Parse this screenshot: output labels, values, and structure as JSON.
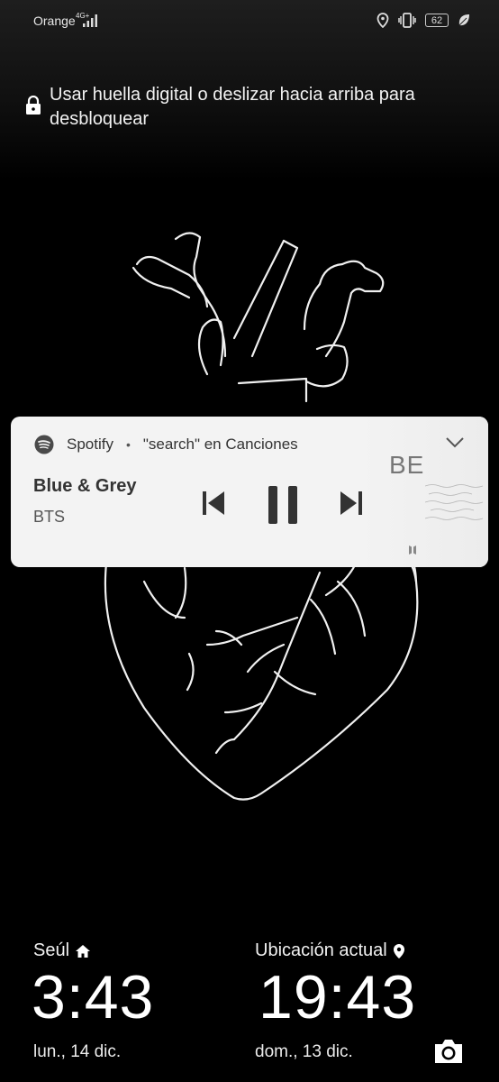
{
  "status_bar": {
    "carrier": "Orange",
    "network": "4G+",
    "battery": "62",
    "icons": [
      "signal-icon",
      "location-icon",
      "vibrate-icon",
      "battery-icon",
      "leaf-icon"
    ]
  },
  "lock": {
    "hint": "Usar huella digital o deslizar hacia arriba para desbloquear"
  },
  "media_notification": {
    "app": "Spotify",
    "separator": "•",
    "context": "\"search\" en Canciones",
    "track_title": "Blue & Grey",
    "artist": "BTS",
    "album_art_text": "BE",
    "controls": [
      "previous-icon",
      "pause-icon",
      "next-icon"
    ],
    "bg_color": "#f3f3f3"
  },
  "clocks": [
    {
      "city": "Seúl",
      "time": "3:43",
      "date": "lun., 14 dic.",
      "icon": "home-icon"
    },
    {
      "city": "Ubicación actual",
      "time": "19:43",
      "date": "dom., 13 dic.",
      "icon": "location-pin-icon"
    }
  ],
  "camera": {
    "icon": "camera-icon"
  }
}
